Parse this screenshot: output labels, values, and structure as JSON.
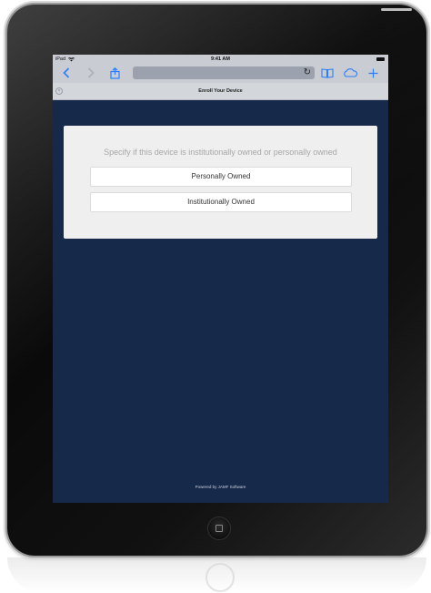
{
  "status_bar": {
    "carrier": "iPad",
    "time": "9:41 AM"
  },
  "toolbar": {
    "back_icon": "chevron-left-icon",
    "forward_icon": "chevron-right-icon",
    "share_icon": "share-icon",
    "reload_icon": "reload-icon",
    "bookmarks_icon": "book-icon",
    "cloud_icon": "cloud-icon",
    "add_icon": "plus-icon",
    "accent": "#2f7df6"
  },
  "tab": {
    "title": "Enroll Your Device"
  },
  "enroll": {
    "prompt": "Specify if this device is institutionally owned or personally owned",
    "options": [
      {
        "label": "Personally Owned"
      },
      {
        "label": "Institutionally Owned"
      }
    ]
  },
  "footer": {
    "text": "Powered by JAMF Software"
  },
  "colors": {
    "page_background": "#17294b",
    "card_background": "#efefef"
  }
}
